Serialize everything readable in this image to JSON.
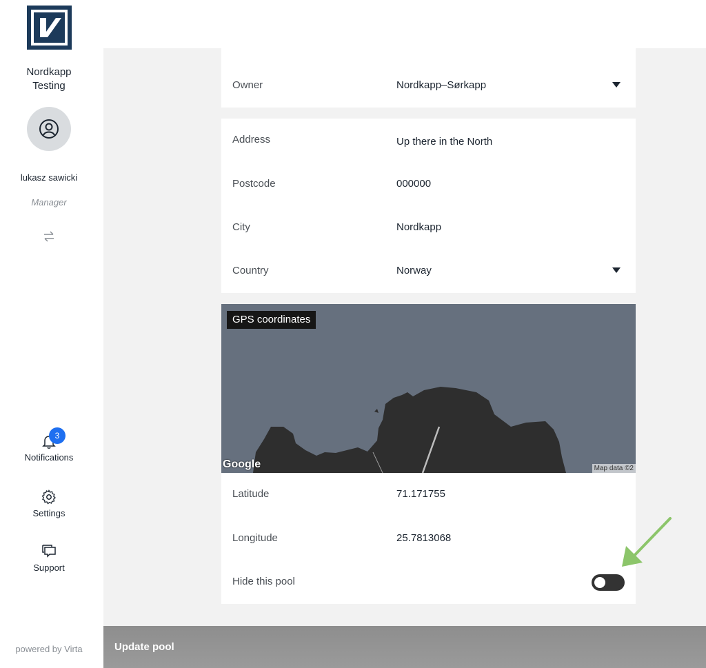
{
  "sidebar": {
    "org_name": "Nordkapp\nTesting",
    "user_name": "lukasz sawicki",
    "user_role": "Manager",
    "notifications": {
      "label": "Notifications",
      "badge": "3"
    },
    "settings_label": "Settings",
    "support_label": "Support",
    "powered_by": "powered by Virta"
  },
  "form": {
    "owner": {
      "label": "Owner",
      "value": "Nordkapp–Sørkapp"
    },
    "address": {
      "label": "Address",
      "value": "Up there in the North"
    },
    "postcode": {
      "label": "Postcode",
      "value": "000000"
    },
    "city": {
      "label": "City",
      "value": "Nordkapp"
    },
    "country": {
      "label": "Country",
      "value": "Norway"
    },
    "map": {
      "label": "GPS coordinates",
      "google": "Google",
      "credit": "Map data ©2"
    },
    "latitude": {
      "label": "Latitude",
      "value": "71.171755"
    },
    "longitude": {
      "label": "Longitude",
      "value": "25.7813068"
    },
    "hide_pool": {
      "label": "Hide this pool",
      "enabled": false
    }
  },
  "footer": {
    "update_label": "Update pool"
  },
  "colors": {
    "accent": "#1e6ff0",
    "arrow": "#8cc56a",
    "map_water": "#66707e",
    "map_land": "#2e2e2e"
  }
}
